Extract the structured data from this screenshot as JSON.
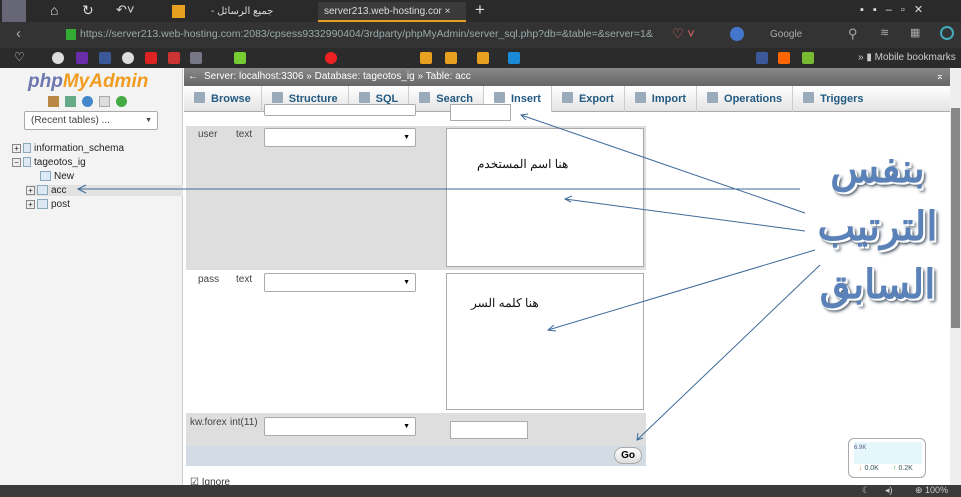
{
  "browser": {
    "tabs": [
      {
        "label": "جميع الرسائل - خصسات"
      },
      {
        "label": "server213.web-hosting.cor",
        "active": true
      }
    ],
    "url": "https://server213.web-hosting.com:2083/cpsess9332990404/3rdparty/phpMyAdmin/server_sql.php?db=&table=&server=1&",
    "search_engine": "Google",
    "bookmarks_more": "Mobile bookmarks",
    "zoom": "100%"
  },
  "sidebar": {
    "logo": "phpMyAdmin",
    "recent_tables": "(Recent tables) ...",
    "tree": [
      {
        "label": "information_schema",
        "toggle": "+"
      },
      {
        "label": "tageotos_ig",
        "toggle": "−"
      },
      {
        "label": "New"
      },
      {
        "label": "acc",
        "toggle": "+"
      },
      {
        "label": "post",
        "toggle": "+"
      }
    ]
  },
  "breadcrumb": {
    "server": "Server: localhost:3306",
    "database": "Database: tageotos_ig",
    "table": "Table: acc",
    "sep": "»"
  },
  "tabs": [
    "Browse",
    "Structure",
    "SQL",
    "Search",
    "Insert",
    "Export",
    "Import",
    "Operations",
    "Triggers"
  ],
  "active_tab": "Insert",
  "form": {
    "rows": [
      {
        "column": "user",
        "type": "text",
        "annotation": "هنا اسم المستخدم"
      },
      {
        "column": "pass",
        "type": "text",
        "annotation": "هنا كلمه السر"
      },
      {
        "column": "kw.forex",
        "type": "int(11)"
      }
    ],
    "go": "Go",
    "ignore": "Ignore"
  },
  "annotation_title": [
    "بنفس",
    "الترتيب",
    "السابق"
  ],
  "net_widget": {
    "scale": "6.9K",
    "down": "0.0K",
    "up": "0.2K"
  },
  "colors": {
    "arrow": "#3e6a9a",
    "accent": "#235a81"
  }
}
